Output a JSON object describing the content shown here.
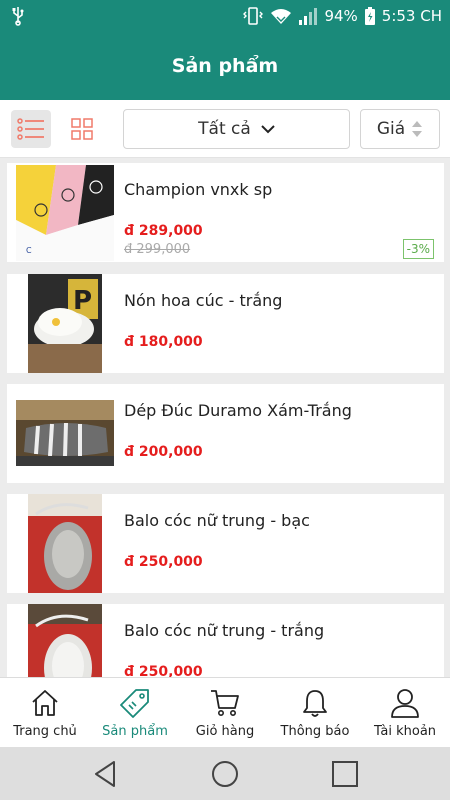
{
  "status_bar": {
    "battery": "94%",
    "time": "5:53 CH"
  },
  "app_bar": {
    "title": "Sản phẩm"
  },
  "toolbar": {
    "filter_value": "Tất cả",
    "sort_label": "Giá"
  },
  "products": [
    {
      "name": "Champion vnxk sp",
      "price": "đ 289,000",
      "old_price": "đ 299,000",
      "discount": "-3%"
    },
    {
      "name": "Nón hoa cúc - trắng",
      "price": "đ 180,000"
    },
    {
      "name": "Dép Đúc Duramo Xám-Trắng",
      "price": "đ 200,000"
    },
    {
      "name": "Balo cóc nữ trung - bạc",
      "price": "đ 250,000"
    },
    {
      "name": "Balo cóc nữ trung - trắng",
      "price": "đ 250,000"
    }
  ],
  "bottom_nav": [
    {
      "label": "Trang chủ",
      "icon": "home-icon"
    },
    {
      "label": "Sản phẩm",
      "icon": "tag-icon",
      "active": true
    },
    {
      "label": "Giỏ hàng",
      "icon": "cart-icon"
    },
    {
      "label": "Thông báo",
      "icon": "bell-icon"
    },
    {
      "label": "Tài khoản",
      "icon": "user-icon"
    }
  ],
  "colors": {
    "primary": "#1a8a7a",
    "price": "#e51d1d",
    "accent_icon": "#f07a6a",
    "badge": "#5aab4a"
  }
}
